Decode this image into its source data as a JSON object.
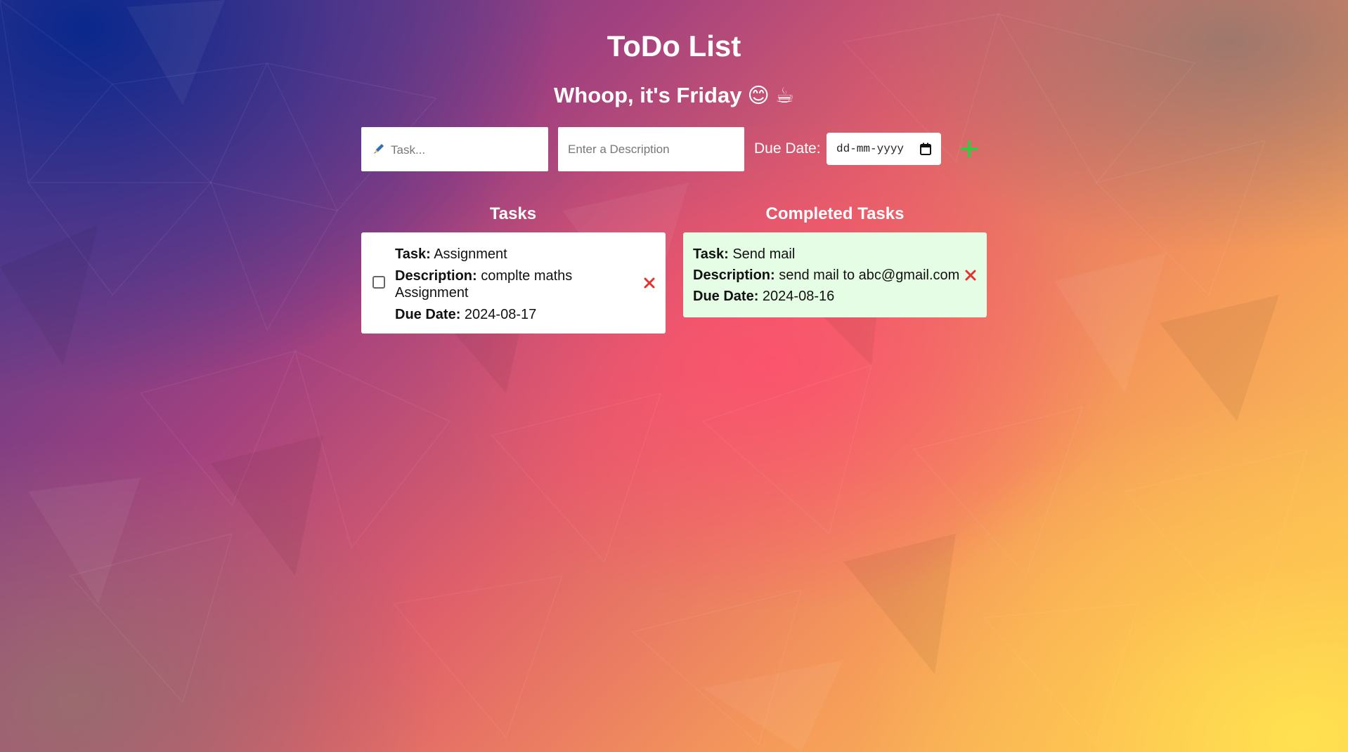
{
  "header": {
    "title": "ToDo List",
    "greeting": "Whoop, it's Friday",
    "greeting_emojis": "😊 ☕"
  },
  "form": {
    "task_placeholder": "Task...",
    "description_placeholder": "Enter a Description",
    "due_date_label": "Due Date:",
    "date_placeholder": "dd-mm-yyyy",
    "add_icon": "plus-icon",
    "add_color": "#2ecc40"
  },
  "tasks": {
    "heading": "Tasks",
    "items": [
      {
        "task_label": "Task:",
        "task": "Assignment",
        "description_label": "Description:",
        "description": "complte maths Assignment",
        "due_label": "Due Date:",
        "due_date": "2024-08-17",
        "completed": false
      }
    ]
  },
  "completed": {
    "heading": "Completed Tasks",
    "items": [
      {
        "task_label": "Task:",
        "task": "Send mail",
        "description_label": "Description:",
        "description": "send mail to abc@gmail.com",
        "due_label": "Due Date:",
        "due_date": "2024-08-16",
        "completed": true
      }
    ]
  },
  "colors": {
    "delete": "#e8312f",
    "completed_card": "#e4fde4"
  }
}
